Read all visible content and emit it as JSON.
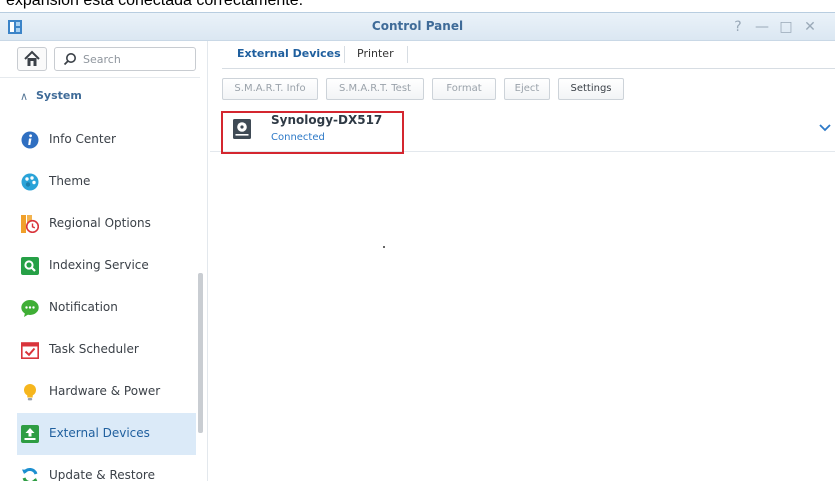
{
  "caption": "expansión está conectada correctamente.",
  "window": {
    "title": "Control Panel",
    "controls": [
      "?",
      "—",
      "□",
      "✕"
    ]
  },
  "sidebar": {
    "search_placeholder": "Search",
    "section_label": "System",
    "items": [
      {
        "label": "Info Center",
        "icon": "info-icon",
        "color": "#2f6fc1"
      },
      {
        "label": "Theme",
        "icon": "palette-icon",
        "color": "#2aa3d8"
      },
      {
        "label": "Regional Options",
        "icon": "regional-clock-icon",
        "color": "#f0a02a"
      },
      {
        "label": "Indexing Service",
        "icon": "indexing-icon",
        "color": "#26a046"
      },
      {
        "label": "Notification",
        "icon": "chat-bubble-icon",
        "color": "#3fae35"
      },
      {
        "label": "Task Scheduler",
        "icon": "calendar-check-icon",
        "color": "#d9343b"
      },
      {
        "label": "Hardware & Power",
        "icon": "lightbulb-icon",
        "color": "#f6b61d"
      },
      {
        "label": "External Devices",
        "icon": "upload-box-icon",
        "color": "#2e9d43"
      },
      {
        "label": "Update & Restore",
        "icon": "refresh-icon",
        "color": "#1c8fd0"
      }
    ],
    "selected_index": 7
  },
  "tabs": [
    {
      "label": "External Devices",
      "active": true
    },
    {
      "label": "Printer",
      "active": false
    }
  ],
  "toolbar": {
    "smart_info": "S.M.A.R.T. Info",
    "smart_test": "S.M.A.R.T. Test",
    "format": "Format",
    "eject": "Eject",
    "settings": "Settings"
  },
  "device": {
    "name": "Synology-DX517",
    "status": "Connected"
  },
  "colors": {
    "accent": "#1f5f9e",
    "highlight": "#d4262f",
    "selected_bg": "#dbeaf8"
  }
}
